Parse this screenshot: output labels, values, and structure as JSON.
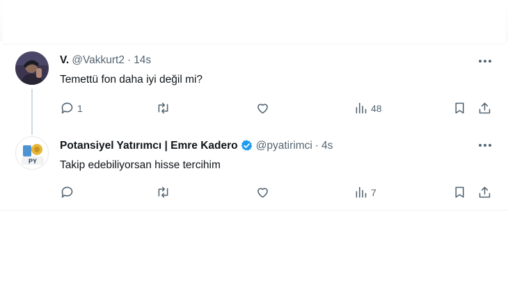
{
  "tweets": [
    {
      "name": "V.",
      "handle": "@Vakkurt2",
      "separator": "·",
      "time": "14s",
      "text": "Temettü fon daha iyi değil mi?",
      "verified": false,
      "actions": {
        "replies": "1",
        "retweets": "",
        "likes": "",
        "views": "48"
      }
    },
    {
      "name": "Potansiyel Yatırımcı | Emre Kadero",
      "handle": "@pyatirimci",
      "separator": "·",
      "time": "4s",
      "text": "Takip edebiliyorsan hisse tercihim",
      "verified": true,
      "avatar_label": "PY",
      "actions": {
        "replies": "",
        "retweets": "",
        "likes": "",
        "views": "7"
      }
    }
  ],
  "colors": {
    "text": "#0f1419",
    "muted": "#536471",
    "verified": "#1d9bf0",
    "border": "#eff3f4"
  },
  "icons": [
    "reply-icon",
    "retweet-icon",
    "like-icon",
    "views-icon",
    "bookmark-icon",
    "share-icon",
    "more-icon",
    "verified-icon"
  ]
}
